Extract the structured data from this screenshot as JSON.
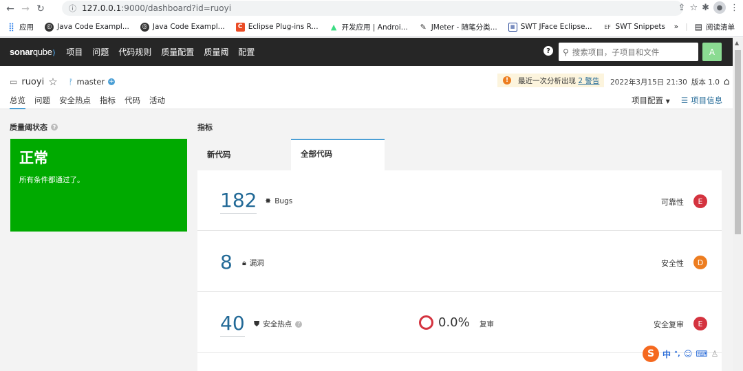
{
  "browser": {
    "url_host": "127.0.0.1",
    "url_path": ":9000/dashboard?id=ruoyi",
    "bookmarks": [
      {
        "label": "应用",
        "icon": "apps-grid-icon"
      },
      {
        "label": "Java Code Exampl...",
        "icon": "globe-icon"
      },
      {
        "label": "Java Code Exampl...",
        "icon": "globe-icon"
      },
      {
        "label": "Eclipse Plug-ins R...",
        "icon": "c-logo-icon"
      },
      {
        "label": "开发应用 | Androi...",
        "icon": "android-icon"
      },
      {
        "label": "JMeter - 随笔分类...",
        "icon": "pen-icon"
      },
      {
        "label": "SWT JFace Eclipse...",
        "icon": "swt-icon"
      },
      {
        "label": "SWT Snippets",
        "icon": "ef-icon"
      }
    ],
    "reading_list": "阅读清单",
    "overflow": "»"
  },
  "topnav": {
    "logo_a": "sonar",
    "logo_b": "qube",
    "items": [
      "项目",
      "问题",
      "代码规则",
      "质量配置",
      "质量阈",
      "配置"
    ],
    "search_placeholder": "搜索项目，子项目和文件",
    "avatar": "A"
  },
  "project": {
    "name": "ruoyi",
    "branch": "master",
    "warning_text": "最近一次分析出现",
    "warning_link": "2 警告",
    "date": "2022年3月15日 21:30",
    "version": "版本 1.0",
    "tabs": [
      "总览",
      "问题",
      "安全热点",
      "指标",
      "代码",
      "活动"
    ],
    "project_config": "项目配置",
    "project_info": "项目信息"
  },
  "quality_gate": {
    "title": "质量阈状态",
    "status": "正常",
    "description": "所有条件都通过了。",
    "color": "#00aa00"
  },
  "measures": {
    "title": "指标",
    "tab_new": "新代码",
    "tab_all": "全部代码",
    "bugs": {
      "value": "182",
      "label": "Bugs",
      "rating_label": "可靠性",
      "rating": "E",
      "rating_color": "#d4333f"
    },
    "vulns": {
      "value": "8",
      "label": "漏洞",
      "rating_label": "安全性",
      "rating": "D",
      "rating_color": "#ed7d20"
    },
    "hotspots": {
      "value": "40",
      "label": "安全热点",
      "reviewed_pct": "0.0%",
      "reviewed_label": "复审",
      "rating_label": "安全复审",
      "rating": "E",
      "rating_color": "#d4333f"
    }
  },
  "ime": {
    "lang": "中",
    "punct": "°,"
  }
}
